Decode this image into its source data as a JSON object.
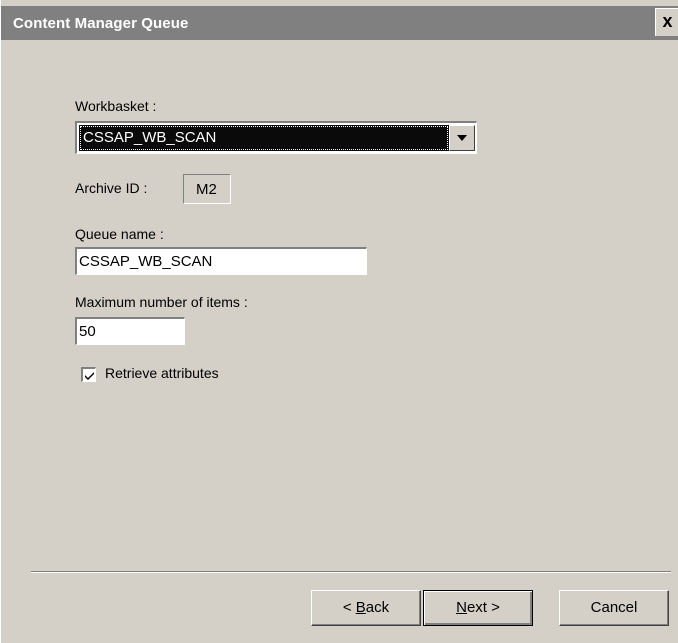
{
  "window": {
    "title": "Content Manager Queue",
    "close_glyph": "x"
  },
  "form": {
    "workbasket": {
      "label": "Workbasket :",
      "selected": "CSSAP_WB_SCAN"
    },
    "archive_id": {
      "label": "Archive ID :",
      "value": "M2"
    },
    "queue_name": {
      "label": "Queue name :",
      "value": "CSSAP_WB_SCAN"
    },
    "max_items": {
      "label": "Maximum number of items :",
      "value": "50"
    },
    "retrieve_attributes": {
      "label": "Retrieve attributes",
      "checked": true
    }
  },
  "buttons": {
    "back": {
      "prefix": "< ",
      "mnemonic": "B",
      "rest": "ack"
    },
    "next": {
      "prefix": "",
      "mnemonic": "N",
      "rest": "ext >"
    },
    "cancel": {
      "label": "Cancel"
    }
  },
  "icons": {
    "close": "close-icon",
    "dropdown": "chevron-down-icon",
    "check": "checkmark-icon"
  }
}
